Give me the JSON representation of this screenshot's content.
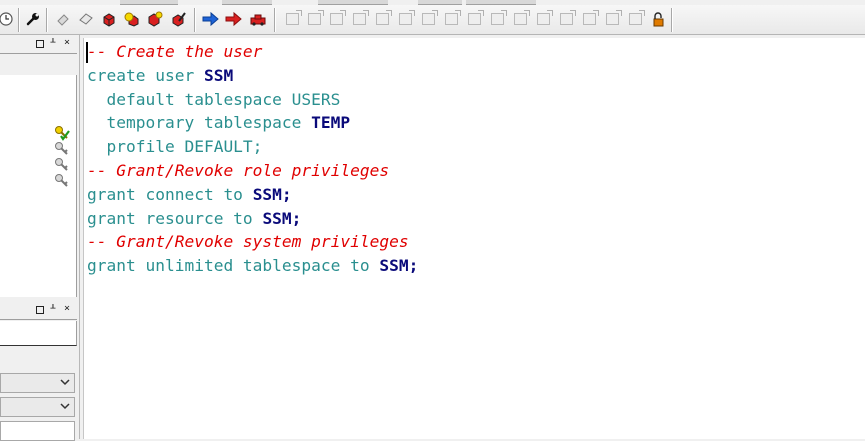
{
  "toolbar": {
    "buttons": [
      {
        "icon": "clock-icon"
      },
      {
        "icon": "wrench-icon"
      },
      {
        "icon": "eraser-icon"
      },
      {
        "icon": "tag-icon"
      },
      {
        "icon": "red-cube-icon"
      },
      {
        "icon": "yellow-star-red-icon"
      },
      {
        "icon": "red-cube-star-icon"
      },
      {
        "icon": "red-brush-icon"
      },
      {
        "icon": "blue-arrow-right-icon"
      },
      {
        "icon": "red-arrow-right-icon"
      },
      {
        "icon": "red-car-icon"
      },
      {
        "icon": "lock-icon"
      }
    ],
    "accent_blue": "#1e63d6",
    "accent_red": "#d92020"
  },
  "left_panel": {
    "panels": [
      {
        "controls": {
          "restore": "▢",
          "pin": "⊥",
          "close": "×"
        }
      },
      {
        "controls": {
          "restore": "▢",
          "pin": "⊥",
          "close": "×"
        }
      }
    ],
    "key_icons": [
      "key-check-icon",
      "key-icon",
      "key-icon",
      "key-icon"
    ]
  },
  "editor": {
    "lines": [
      {
        "parts": [
          {
            "t": "-- Create the user",
            "k": "comment"
          }
        ]
      },
      {
        "parts": [
          {
            "t": "create user ",
            "k": "kw"
          },
          {
            "t": "SSM",
            "k": "id"
          }
        ]
      },
      {
        "parts": [
          {
            "t": "  default tablespace USERS",
            "k": "kw"
          }
        ]
      },
      {
        "parts": [
          {
            "t": "  temporary tablespace ",
            "k": "kw"
          },
          {
            "t": "TEMP",
            "k": "id"
          }
        ]
      },
      {
        "parts": [
          {
            "t": "  profile DEFAULT;",
            "k": "kw"
          }
        ]
      },
      {
        "parts": [
          {
            "t": "-- Grant/Revoke role privileges",
            "k": "comment"
          }
        ]
      },
      {
        "parts": [
          {
            "t": "grant connect to ",
            "k": "kw"
          },
          {
            "t": "SSM;",
            "k": "id"
          }
        ]
      },
      {
        "parts": [
          {
            "t": "grant resource to ",
            "k": "kw"
          },
          {
            "t": "SSM;",
            "k": "id"
          }
        ]
      },
      {
        "parts": [
          {
            "t": "-- Grant/Revoke system privileges",
            "k": "comment"
          }
        ]
      },
      {
        "parts": [
          {
            "t": "grant unlimited tablespace to ",
            "k": "kw"
          },
          {
            "t": "SSM;",
            "k": "id"
          }
        ]
      }
    ],
    "colors": {
      "comment": "#e00000",
      "keyword": "#2a8f8f",
      "identifier": "#0a0a7a"
    }
  }
}
